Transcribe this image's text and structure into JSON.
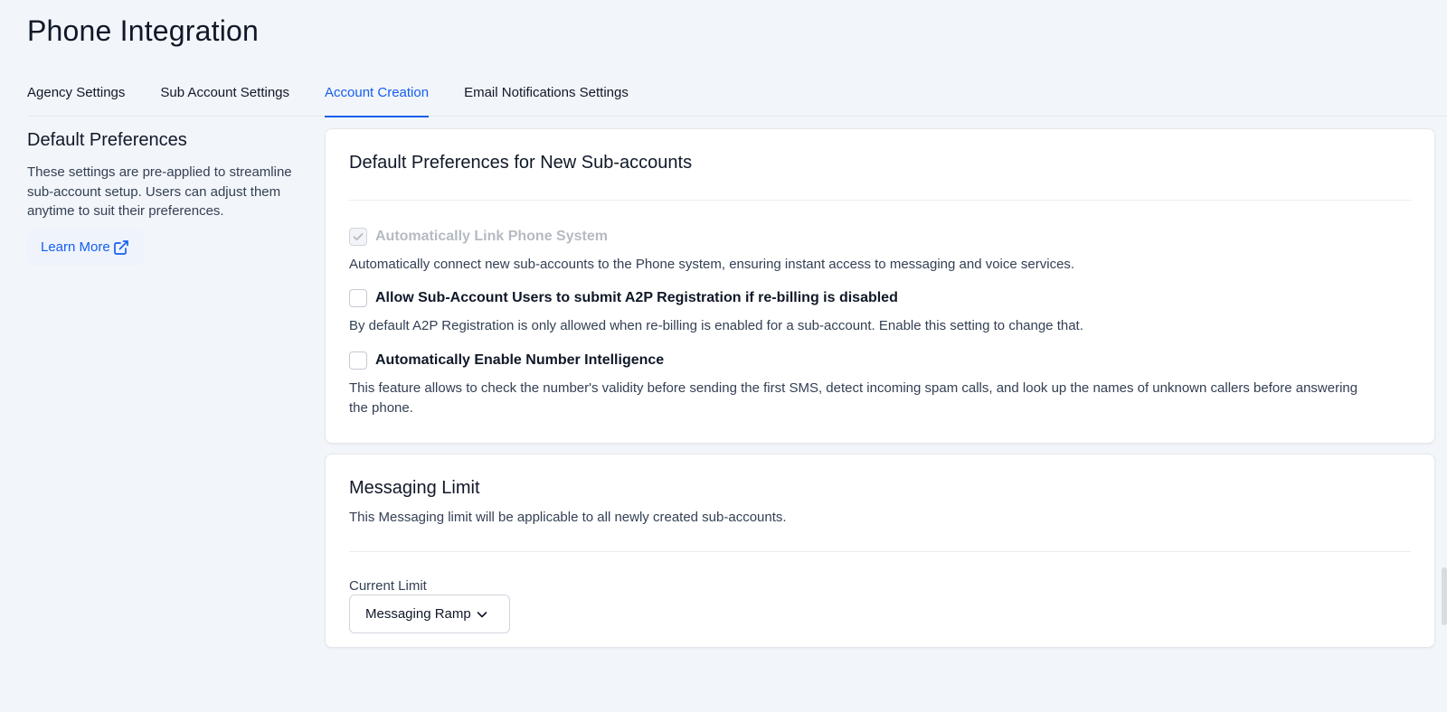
{
  "page": {
    "title": "Phone Integration"
  },
  "tabs": [
    {
      "label": "Agency Settings",
      "active": false
    },
    {
      "label": "Sub Account Settings",
      "active": false
    },
    {
      "label": "Account Creation",
      "active": true
    },
    {
      "label": "Email Notifications Settings",
      "active": false
    }
  ],
  "left": {
    "title": "Default Preferences",
    "description": "These settings are pre-applied to streamline sub-account setup. Users can adjust them anytime to suit their preferences.",
    "learn_more": "Learn More"
  },
  "defaults_card": {
    "title": "Default Preferences for New Sub-accounts",
    "prefs": [
      {
        "label": "Automatically Link Phone System",
        "description": "Automatically connect new sub-accounts to the Phone system, ensuring instant access to messaging and voice services.",
        "checked": true,
        "disabled": true
      },
      {
        "label": "Allow Sub-Account Users to submit A2P Registration if re-billing is disabled",
        "description": "By default A2P Registration is only allowed when re-billing is enabled for a sub-account. Enable this setting to change that.",
        "checked": false,
        "disabled": false
      },
      {
        "label": "Automatically Enable Number Intelligence",
        "description": "This feature allows to check the number's validity before sending the first SMS, detect incoming spam calls, and look up the names of unknown callers before answering the phone.",
        "checked": false,
        "disabled": false
      }
    ]
  },
  "messaging_card": {
    "title": "Messaging Limit",
    "subtitle": "This Messaging limit will be applicable to all newly created sub-accounts.",
    "current_limit_label": "Current Limit",
    "current_limit_value": "Messaging Ramp"
  },
  "colors": {
    "accent": "#155eef",
    "background": "#f2f5f9",
    "text": "#101828",
    "muted_text": "#344054",
    "disabled_text": "#b5bac3"
  },
  "icons": {
    "learn_more": "external-link-icon",
    "select": "chevron-down-icon",
    "checkbox": "check-icon"
  }
}
